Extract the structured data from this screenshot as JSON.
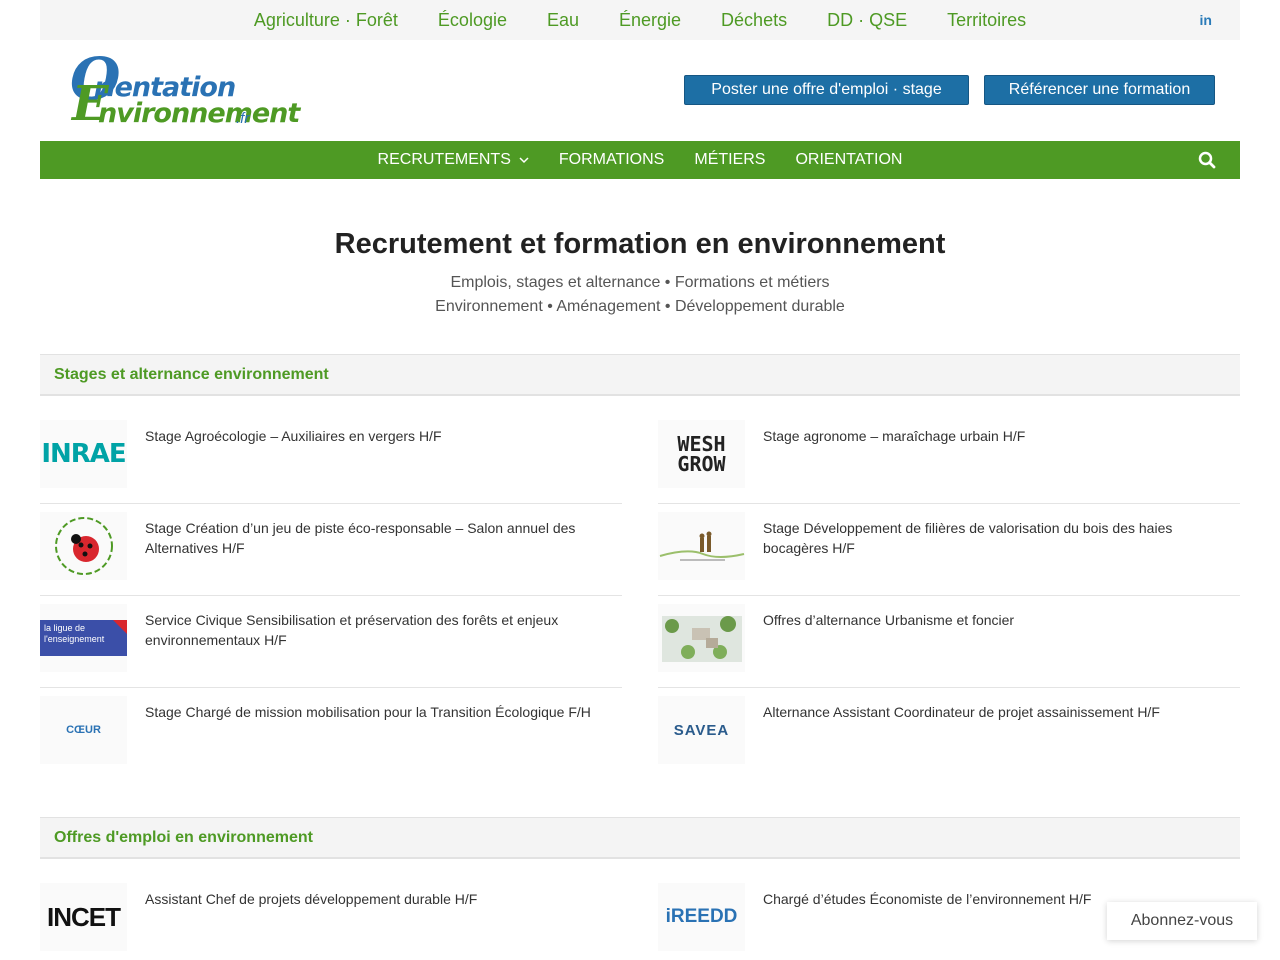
{
  "topnav": {
    "items": [
      "Agriculture · Forêt",
      "Écologie",
      "Eau",
      "Énergie",
      "Déchets",
      "DD · QSE",
      "Territoires"
    ],
    "linkedin": "in"
  },
  "logo": {
    "o": "O",
    "line1": "rientation",
    "e": "E",
    "line2": "nvironnement",
    "fr": ".fr"
  },
  "header": {
    "post_label": "Poster une offre d'emploi · stage",
    "ref_label": "Référencer une formation"
  },
  "mainnav": {
    "items": [
      "RECRUTEMENTS",
      "FORMATIONS",
      "MÉTIERS",
      "ORIENTATION"
    ],
    "dropdown_icon": "chevron-down-icon",
    "search_icon": "search-icon"
  },
  "hero": {
    "title": "Recrutement et formation en environnement",
    "line1": "Emplois, stages et alternance • Formations et métiers",
    "line2": "Environnement • Aménagement • Développement durable"
  },
  "sections": [
    {
      "title": "Stages et alternance environnement",
      "items": [
        {
          "logo": "INRAE",
          "title": "Stage Agroécologie – Auxiliaires en vergers H/F"
        },
        {
          "logo": "WESH GROW",
          "title": "Stage agronome – maraîchage urbain H/F"
        },
        {
          "logo": "ladybug-logo",
          "title": "Stage Création d’un jeu de piste éco-responsable – Salon annuel des Alternatives H/F"
        },
        {
          "logo": "farmers-logo",
          "title": "Stage Développement de filières de valorisation du bois des haies bocagères H/F"
        },
        {
          "logo": "la ligue de l'enseignement",
          "title": "Service Civique Sensibilisation et préservation des forêts et enjeux environnementaux H/F"
        },
        {
          "logo": "city-aerial-image",
          "title": "Offres d’alternance Urbanisme et foncier"
        },
        {
          "logo": "CŒUR",
          "title": "Stage Chargé de mission mobilisation pour la Transition Écologique F/H"
        },
        {
          "logo": "SAVEA",
          "title": "Alternance Assistant Coordinateur de projet assainissement H/F"
        }
      ]
    },
    {
      "title": "Offres d'emploi en environnement",
      "items": [
        {
          "logo": "INCET",
          "title": "Assistant Chef de projets développement durable H/F"
        },
        {
          "logo": "iREEDD",
          "title": "Chargé d’études Économiste de l’environnement H/F"
        }
      ]
    }
  ],
  "abonnez_label": "Abonnez-vous",
  "colors": {
    "green": "#4e9a24",
    "blue": "#1d6fa5"
  }
}
